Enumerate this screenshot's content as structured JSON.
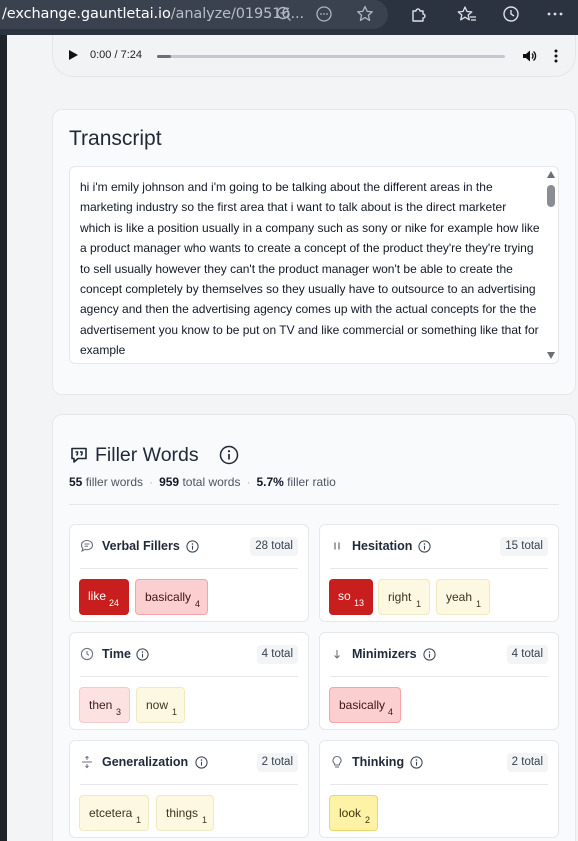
{
  "browser": {
    "url_host": "/exchange.gauntletai.io",
    "url_path": "/analyze/019516...",
    "icons": [
      "zoom-out-icon",
      "reader-icon",
      "favorite-star-icon",
      "extensions-icon",
      "favorites-icon",
      "history-icon",
      "more-icon"
    ]
  },
  "audio": {
    "time": "0:00 / 7:24",
    "progress_fraction": 0.0
  },
  "transcript": {
    "title": "Transcript",
    "text": "hi i'm emily johnson and i'm going to be talking about the different areas in the marketing industry so the first area that i want to talk about is the direct marketer which is like a position usually in a company such as sony or nike for example how like a product manager who wants to create a concept of the product they're they're trying to sell usually however they can't the product manager won't be able to create the concept completely by themselves so they usually have to outsource to an advertising agency and then the advertising agency comes up with the actual concepts for the the advertisement you know to be put on TV and like commercial or something like that for example"
  },
  "filler": {
    "title": "Filler Words",
    "filler_count": "55",
    "filler_label": "filler words",
    "total_count": "959",
    "total_label": "total words",
    "ratio": "5.7%",
    "ratio_label": "filler ratio",
    "categories": [
      {
        "name": "Verbal Fillers",
        "total": "28 total",
        "icon": "speech-bubble-icon",
        "chips": [
          {
            "word": "like",
            "count": "24"
          },
          {
            "word": "basically",
            "count": "4"
          }
        ]
      },
      {
        "name": "Hesitation",
        "total": "15 total",
        "icon": "pause-icon",
        "chips": [
          {
            "word": "so",
            "count": "13"
          },
          {
            "word": "right",
            "count": "1"
          },
          {
            "word": "yeah",
            "count": "1"
          }
        ]
      },
      {
        "name": "Time",
        "total": "4 total",
        "icon": "clock-icon",
        "chips": [
          {
            "word": "then",
            "count": "3"
          },
          {
            "word": "now",
            "count": "1"
          }
        ]
      },
      {
        "name": "Minimizers",
        "total": "4 total",
        "icon": "arrow-down-icon",
        "chips": [
          {
            "word": "basically",
            "count": "4"
          }
        ]
      },
      {
        "name": "Generalization",
        "total": "2 total",
        "icon": "expand-vertical-icon",
        "chips": [
          {
            "word": "etcetera",
            "count": "1"
          },
          {
            "word": "things",
            "count": "1"
          }
        ]
      },
      {
        "name": "Thinking",
        "total": "2 total",
        "icon": "lightbulb-icon",
        "chips": [
          {
            "word": "look",
            "count": "2"
          }
        ]
      }
    ]
  }
}
